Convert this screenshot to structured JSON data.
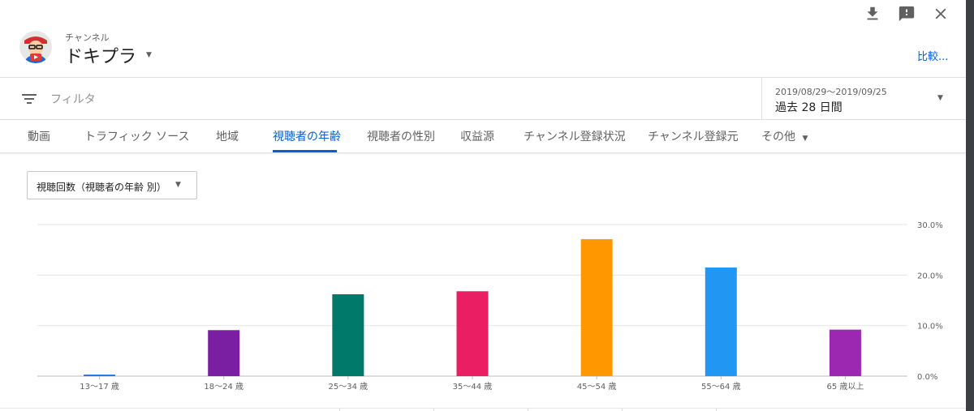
{
  "header": {
    "channel_caption": "チャンネル",
    "channel_name": "ドキプラ",
    "compare_link": "比較..."
  },
  "icons": {
    "download": "download-icon",
    "feedback": "feedback-icon",
    "close": "close-icon",
    "filter": "filter-icon"
  },
  "filter": {
    "placeholder": "フィルタ",
    "date_range": "2019/08/29〜2019/09/25",
    "date_label": "過去 28 日間"
  },
  "tabs": [
    {
      "label": "動画",
      "active": false
    },
    {
      "label": "トラフィック ソース",
      "active": false
    },
    {
      "label": "地域",
      "active": false
    },
    {
      "label": "視聴者の年齢",
      "active": true
    },
    {
      "label": "視聴者の性別",
      "active": false
    },
    {
      "label": "収益源",
      "active": false
    },
    {
      "label": "チャンネル登録状況",
      "active": false
    },
    {
      "label": "チャンネル登録元",
      "active": false
    },
    {
      "label": "その他",
      "active": false
    }
  ],
  "metric_select": {
    "label": "視聴回数（視聴者の年齢 別）"
  },
  "colors": {
    "accent": "#065fd4",
    "grid": "#e6e6e6"
  },
  "chart_data": {
    "type": "bar",
    "categories": [
      "13〜17 歳",
      "18〜24 歳",
      "25〜34 歳",
      "35〜44 歳",
      "45〜54 歳",
      "55〜64 歳",
      "65 歳以上"
    ],
    "values": [
      0.3,
      9.1,
      16.2,
      16.8,
      27.1,
      21.5,
      9.2
    ],
    "colors": [
      "#1a73e8",
      "#7b1fa2",
      "#00796b",
      "#e91e63",
      "#ff9800",
      "#2196f3",
      "#9c27b0"
    ],
    "ytick_labels": [
      "0.0%",
      "10.0%",
      "20.0%",
      "30.0%"
    ],
    "ylim": [
      0,
      30
    ],
    "grid": true
  }
}
